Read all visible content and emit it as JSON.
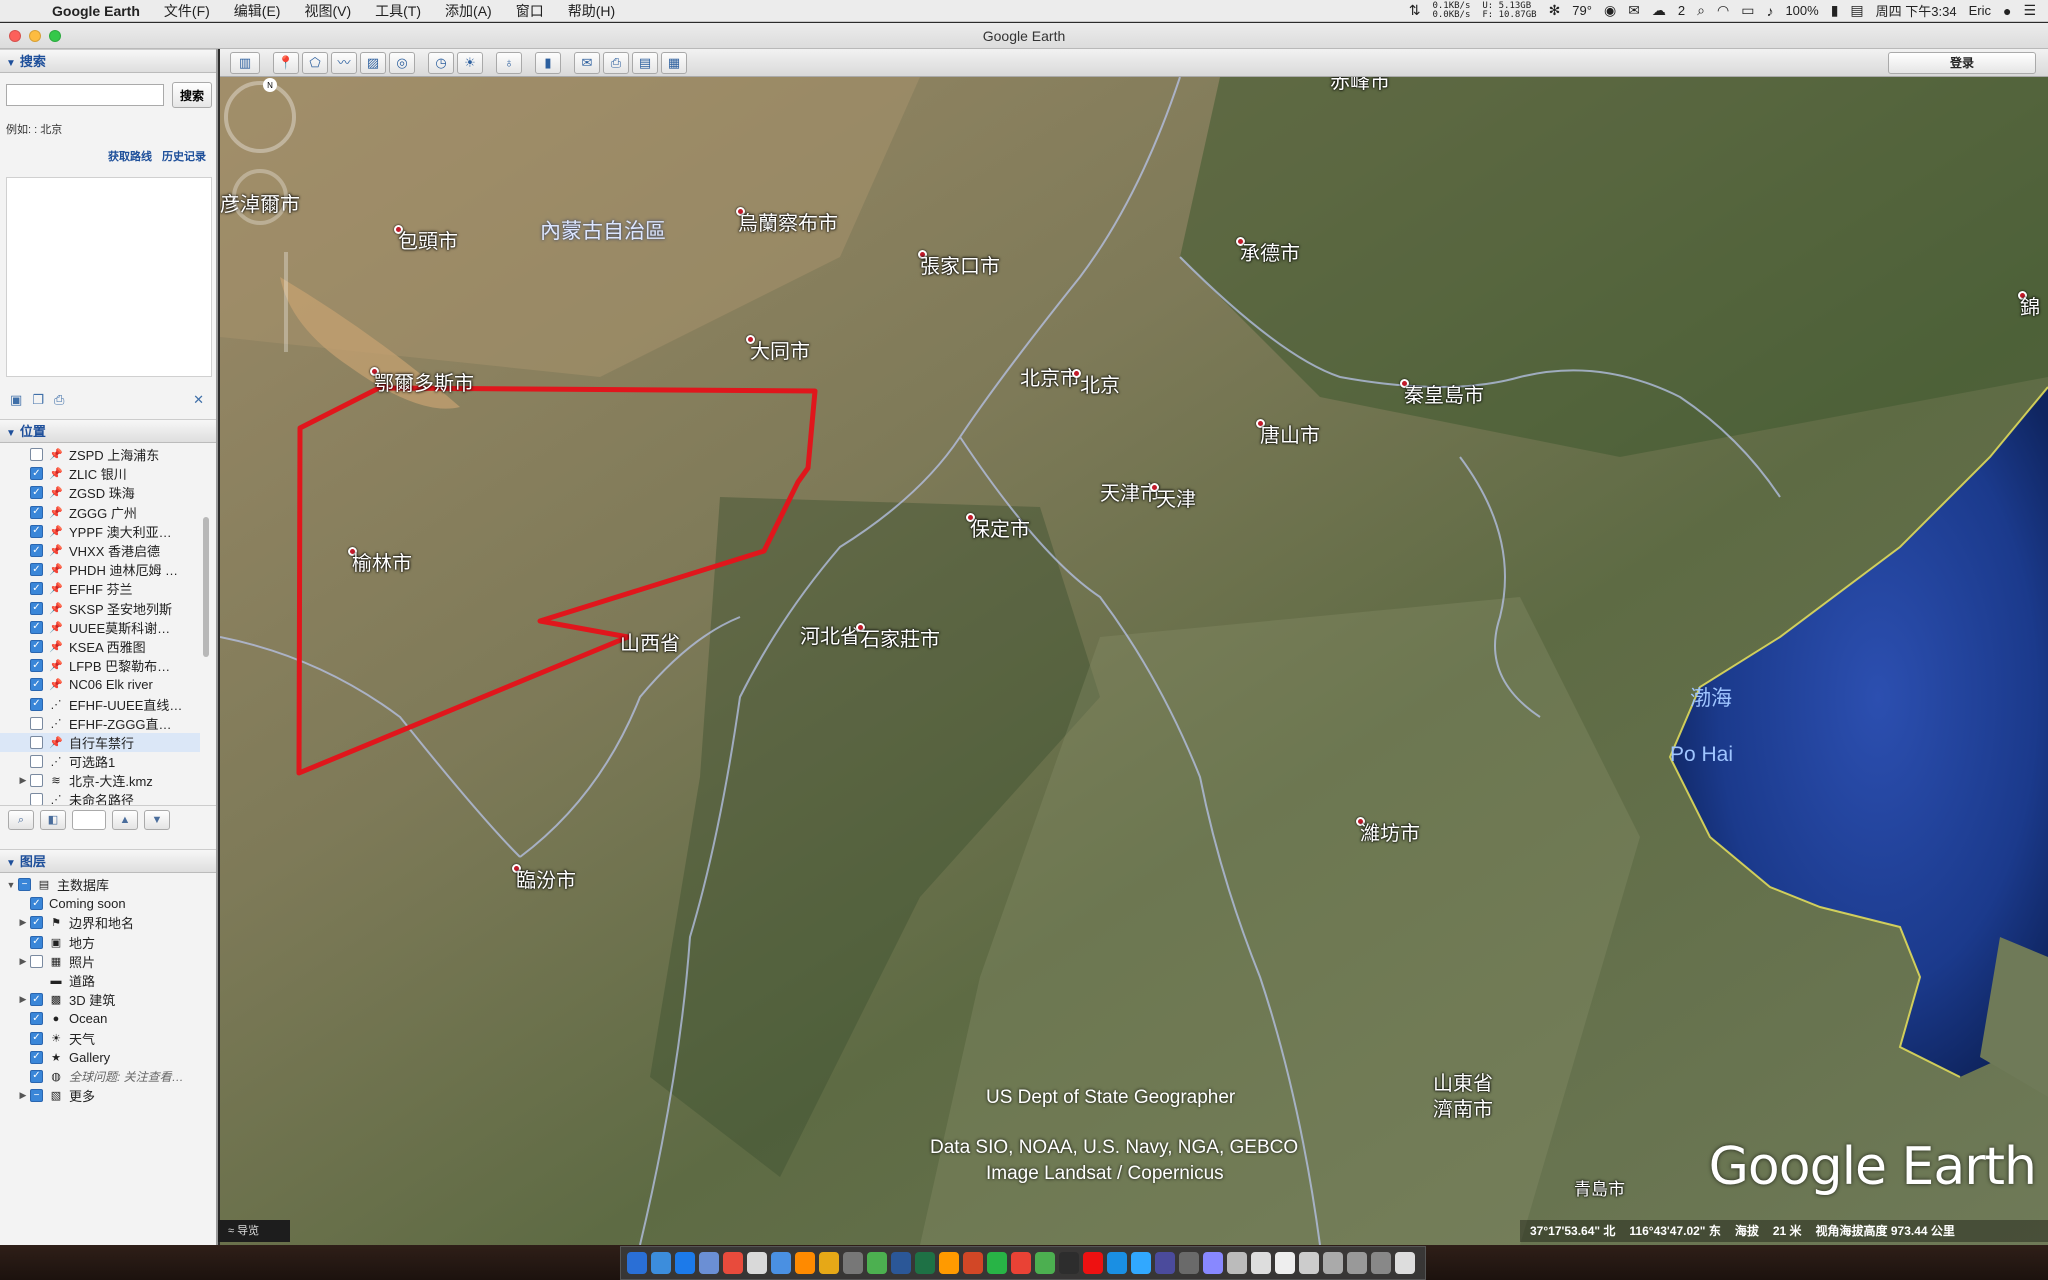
{
  "menubar": {
    "app_name": "Google Earth",
    "menus": [
      "文件(F)",
      "编辑(E)",
      "视图(V)",
      "工具(T)",
      "添加(A)",
      "窗口",
      "帮助(H)"
    ],
    "net_up": "0.1KB/s",
    "net_down": "0.0KB/s",
    "mem_u": "U:  5.13GB",
    "mem_f": "F: 10.87GB",
    "temperature": "79°",
    "wechat_count": "2",
    "battery": "100%",
    "datetime": "周四 下午3:34",
    "user": "Eric"
  },
  "window": {
    "title": "Google Earth"
  },
  "search": {
    "header": "搜索",
    "button": "搜索",
    "example": "例如: : 北京",
    "link_directions": "获取路线",
    "link_history": "历史记录"
  },
  "places": {
    "header": "位置",
    "items": [
      {
        "label": "ZSPD 上海浦东",
        "checked": false,
        "icon": "pushpin-icon"
      },
      {
        "label": "ZLIC 银川",
        "checked": true,
        "icon": "pushpin-icon"
      },
      {
        "label": "ZGSD 珠海",
        "checked": true,
        "icon": "pushpin-icon"
      },
      {
        "label": "ZGGG 广州",
        "checked": true,
        "icon": "pushpin-icon"
      },
      {
        "label": "YPPF 澳大利亚…",
        "checked": true,
        "icon": "pushpin-icon"
      },
      {
        "label": "VHXX 香港启德",
        "checked": true,
        "icon": "pushpin-icon"
      },
      {
        "label": "PHDH 迪林厄姆 …",
        "checked": true,
        "icon": "pushpin-icon"
      },
      {
        "label": "EFHF 芬兰",
        "checked": true,
        "icon": "pushpin-icon"
      },
      {
        "label": "SKSP 圣安地列斯",
        "checked": true,
        "icon": "pushpin-icon"
      },
      {
        "label": "UUEE莫斯科谢…",
        "checked": true,
        "icon": "pushpin-icon"
      },
      {
        "label": "KSEA 西雅图",
        "checked": true,
        "icon": "pushpin-icon"
      },
      {
        "label": "LFPB 巴黎勒布…",
        "checked": true,
        "icon": "pushpin-icon"
      },
      {
        "label": "NC06 Elk river",
        "checked": true,
        "icon": "pushpin-icon"
      },
      {
        "label": "EFHF-UUEE直线…",
        "checked": true,
        "icon": "path-icon"
      },
      {
        "label": "EFHF-ZGGG直…",
        "checked": false,
        "icon": "path-icon"
      },
      {
        "label": "自行车禁行",
        "checked": false,
        "icon": "pushpin-icon",
        "selected": true
      },
      {
        "label": "可选路1",
        "checked": false,
        "icon": "path-icon"
      },
      {
        "label": "北京-大连.kmz",
        "checked": false,
        "icon": "kmz-icon",
        "expandable": true
      },
      {
        "label": "未命名路径",
        "checked": false,
        "icon": "path-icon"
      }
    ]
  },
  "layers": {
    "header": "图层",
    "items": [
      {
        "label": "主数据库",
        "state": "partial",
        "expandable": true,
        "indent": 0
      },
      {
        "label": "Coming soon",
        "state": "on",
        "indent": 1
      },
      {
        "label": "边界和地名",
        "state": "on",
        "expandable": true,
        "indent": 1
      },
      {
        "label": "地方",
        "state": "on",
        "indent": 1
      },
      {
        "label": "照片",
        "state": "off",
        "expandable": true,
        "indent": 1
      },
      {
        "label": "道路",
        "state": "none",
        "indent": 1
      },
      {
        "label": "3D 建筑",
        "state": "on",
        "expandable": true,
        "indent": 1
      },
      {
        "label": "Ocean",
        "state": "on",
        "indent": 1
      },
      {
        "label": "天气",
        "state": "on",
        "indent": 1
      },
      {
        "label": "Gallery",
        "state": "on",
        "indent": 1
      },
      {
        "label": "全球问题: 关注查看…",
        "state": "on",
        "indent": 1,
        "italic": true
      },
      {
        "label": "更多",
        "state": "partial",
        "expandable": true,
        "indent": 1
      }
    ]
  },
  "toolbar": {
    "signin": "登录"
  },
  "map": {
    "cities": [
      {
        "label": "赤峰市"
      },
      {
        "label": "巴彦淖爾市"
      },
      {
        "label": "包頭市"
      },
      {
        "label": "烏蘭察布市"
      },
      {
        "label": "張家口市"
      },
      {
        "label": "承德市"
      },
      {
        "label": "錦"
      },
      {
        "label": "大同市"
      },
      {
        "label": "鄂爾多斯市"
      },
      {
        "label": "北京市"
      },
      {
        "label": "北京"
      },
      {
        "label": "秦皇島市"
      },
      {
        "label": "唐山市"
      },
      {
        "label": "天津市"
      },
      {
        "label": "天津"
      },
      {
        "label": "保定市"
      },
      {
        "label": "榆林市"
      },
      {
        "label": "山西省"
      },
      {
        "label": "河北省"
      },
      {
        "label": "石家莊市"
      },
      {
        "label": "山東省"
      },
      {
        "label": "濟南市"
      },
      {
        "label": "濰坊市"
      },
      {
        "label": "臨汾市"
      },
      {
        "label": "青島市"
      }
    ],
    "regions": [
      "內蒙古自治區"
    ],
    "seas": [
      "渤海",
      "Po Hai"
    ],
    "credits": [
      "US Dept of State Geographer",
      "Data SIO, NOAA, U.S. Navy, NGA, GEBCO",
      "Image Landsat / Copernicus"
    ],
    "logo": "Google Earth",
    "path_color": "#e0161c",
    "sea_color": "#1b3a8c"
  },
  "tour": "导览",
  "status": {
    "lat": "37°17'53.64\" 北",
    "lon": "116°43'47.02\" 东",
    "elev_label": "海拔",
    "elev": "21 米",
    "eye": "视角海拔高度 973.44 公里"
  }
}
